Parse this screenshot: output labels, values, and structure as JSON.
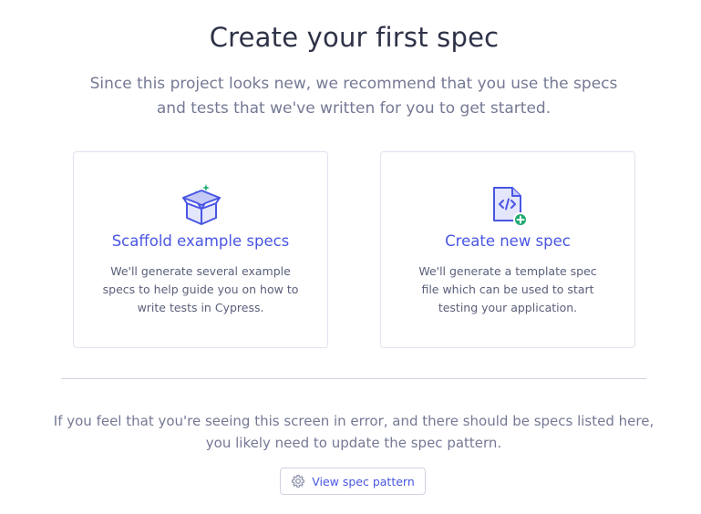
{
  "header": {
    "title": "Create your first spec",
    "subtitle": "Since this project looks new, we recommend that you use the specs and tests that we've written for you to get started."
  },
  "cards": [
    {
      "icon": "box-icon",
      "title": "Scaffold example specs",
      "description": "We'll generate several example specs to help guide you on how to write tests in Cypress."
    },
    {
      "icon": "new-file-code-icon",
      "title": "Create new spec",
      "description": "We'll generate a template spec file which can be used to start testing your application."
    }
  ],
  "footer": {
    "note": "If you feel that you're seeing this screen in error, and there should be specs listed here, you likely need to update the spec pattern.",
    "button": {
      "icon": "gear-icon",
      "label": "View spec pattern"
    }
  },
  "colors": {
    "accent": "#4956e3",
    "accent_light": "#c5c9f6",
    "success": "#1fa971",
    "title_text": "#2e3247",
    "muted_text": "#747994",
    "border": "#e1e3ed"
  }
}
